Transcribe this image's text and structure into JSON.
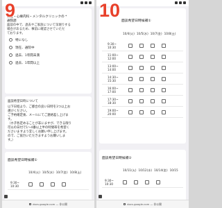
{
  "left": {
    "step": "9",
    "question_lines": [
      "職歴・心療内科・メンタルクリニックの *",
      "通院歴",
      "面談の中で、過去やご家族について深堀りする",
      "場合があるため、事前に確認させていただ",
      "ております。"
    ],
    "options": [
      "特になし",
      "現在、通院中",
      "過去、1年間未満",
      "過去、1年間以上"
    ],
    "desc_lines": [
      "面談希望日時について",
      "以下日程より、ご都合の良い日時を3つ以上お",
      "選びください。",
      "ご予約確定後、メールにてご連絡差し上げま",
      "す。",
      "（ホ子各定めることが非にますが、できる限り",
      "可以の日付で1～4番以上半の時間帯を希望く",
      "ださいますよう宜しくお願い申し上げます。",
      "ので、ご協力いただきますようお願いしま",
      "す。）"
    ],
    "sched_title": "面談希望日時候補①",
    "headers": [
      "10/4(火)",
      "10/5(水)",
      "10/7(金)",
      "10/8(土)"
    ],
    "first_time": [
      "9:30~",
      "10:30"
    ]
  },
  "right": {
    "step": "10",
    "top_title": "面談希望日時候補①",
    "headers": [
      "10/4(火)",
      "10/5(水)",
      "10/7(金)",
      "10/8(土)"
    ],
    "rows": [
      [
        "9:30~",
        "10:30"
      ],
      [
        "11:00~",
        "12:00"
      ],
      [
        "13:00~",
        "14:00"
      ],
      [
        "14:30~",
        "15:30"
      ],
      [
        "16:00~",
        "17:00"
      ],
      [
        "17:30~",
        "18:30"
      ],
      [
        "19:00~",
        "20:00"
      ]
    ],
    "sched2_title": "面談希望日時候補②",
    "headers2": [
      "10/11(火)",
      "10/12(水)",
      "10/14(金)",
      "10/15"
    ],
    "first_time2": [
      "9:30~",
      "10:30"
    ]
  },
  "url": "docs.google.com — 非公開"
}
